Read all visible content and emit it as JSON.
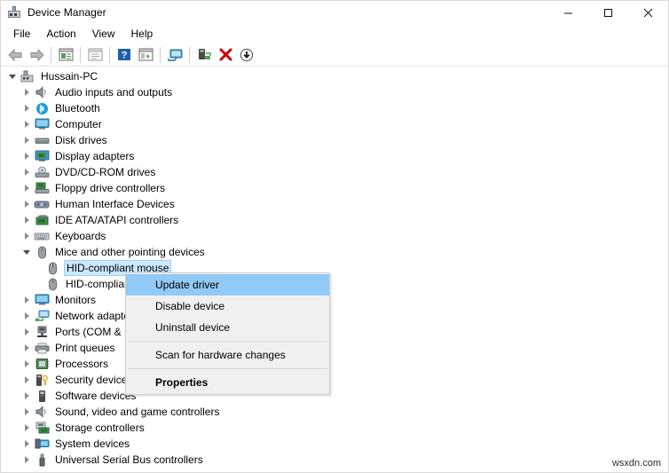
{
  "window": {
    "title": "Device Manager",
    "icon": "computer-icon",
    "controls": {
      "minimize": "minimize-icon",
      "maximize": "maximize-icon",
      "close": "close-icon"
    }
  },
  "menubar": {
    "items": [
      {
        "label": "File"
      },
      {
        "label": "Action"
      },
      {
        "label": "View"
      },
      {
        "label": "Help"
      }
    ]
  },
  "toolbar": {
    "items": [
      {
        "name": "back-icon"
      },
      {
        "name": "forward-icon"
      },
      {
        "name": "separator"
      },
      {
        "name": "properties-icon"
      },
      {
        "name": "separator"
      },
      {
        "name": "help-icon"
      },
      {
        "name": "separator"
      },
      {
        "name": "question-icon"
      },
      {
        "name": "show-hidden-devices-icon"
      },
      {
        "name": "separator"
      },
      {
        "name": "update-display-icon"
      },
      {
        "name": "separator"
      },
      {
        "name": "scan-hardware-changes-icon"
      },
      {
        "name": "uninstall-device-icon"
      },
      {
        "name": "update-driver-icon"
      }
    ]
  },
  "tree": {
    "root": {
      "label": "Hussain-PC",
      "icon": "computer-icon",
      "expanded": true,
      "level": 0
    },
    "items": [
      {
        "label": "Audio inputs and outputs",
        "icon": "speaker-icon",
        "level": 1,
        "expanded": false
      },
      {
        "label": "Bluetooth",
        "icon": "bluetooth-icon",
        "level": 1,
        "expanded": false
      },
      {
        "label": "Computer",
        "icon": "monitor-icon",
        "level": 1,
        "expanded": false
      },
      {
        "label": "Disk drives",
        "icon": "disk-icon",
        "level": 1,
        "expanded": false
      },
      {
        "label": "Display adapters",
        "icon": "display-adapter-icon",
        "level": 1,
        "expanded": false
      },
      {
        "label": "DVD/CD-ROM drives",
        "icon": "dvd-icon",
        "level": 1,
        "expanded": false
      },
      {
        "label": "Floppy drive controllers",
        "icon": "floppy-controller-icon",
        "level": 1,
        "expanded": false
      },
      {
        "label": "Human Interface Devices",
        "icon": "hid-icon",
        "level": 1,
        "expanded": false
      },
      {
        "label": "IDE ATA/ATAPI controllers",
        "icon": "ide-controller-icon",
        "level": 1,
        "expanded": false
      },
      {
        "label": "Keyboards",
        "icon": "keyboard-icon",
        "level": 1,
        "expanded": false
      },
      {
        "label": "Mice and other pointing devices",
        "icon": "mouse-icon",
        "level": 1,
        "expanded": true
      },
      {
        "label": "HID-compliant mouse",
        "icon": "mouse-icon",
        "level": 2,
        "selected": true
      },
      {
        "label": "HID-compliant mouse",
        "icon": "mouse-icon",
        "level": 2
      },
      {
        "label": "Monitors",
        "icon": "monitor-icon",
        "level": 1,
        "expanded": false
      },
      {
        "label": "Network adapters",
        "icon": "network-icon",
        "level": 1,
        "expanded": false
      },
      {
        "label": "Ports (COM & LPT)",
        "icon": "port-icon",
        "level": 1,
        "expanded": false
      },
      {
        "label": "Print queues",
        "icon": "printer-icon",
        "level": 1,
        "expanded": false
      },
      {
        "label": "Processors",
        "icon": "processor-icon",
        "level": 1,
        "expanded": false
      },
      {
        "label": "Security devices",
        "icon": "security-icon",
        "level": 1,
        "expanded": false
      },
      {
        "label": "Software devices",
        "icon": "software-device-icon",
        "level": 1,
        "expanded": false
      },
      {
        "label": "Sound, video and game controllers",
        "icon": "speaker-icon",
        "level": 1,
        "expanded": false
      },
      {
        "label": "Storage controllers",
        "icon": "storage-controller-icon",
        "level": 1,
        "expanded": false
      },
      {
        "label": "System devices",
        "icon": "system-device-icon",
        "level": 1,
        "expanded": false
      },
      {
        "label": "Universal Serial Bus controllers",
        "icon": "usb-icon",
        "level": 1,
        "expanded": false
      }
    ]
  },
  "context_menu": {
    "items": [
      {
        "label": "Update driver",
        "highlight": true
      },
      {
        "label": "Disable device"
      },
      {
        "label": "Uninstall device"
      },
      {
        "separator": true
      },
      {
        "label": "Scan for hardware changes"
      },
      {
        "separator": true
      },
      {
        "label": "Properties",
        "bold": true
      }
    ]
  },
  "watermark": {
    "text": "wsxdn.com"
  },
  "colors": {
    "selection": "#cce8ff",
    "menu_highlight": "#91c9f7",
    "menu_background": "#f0f0f0",
    "accent_blue": "#0078d7"
  }
}
